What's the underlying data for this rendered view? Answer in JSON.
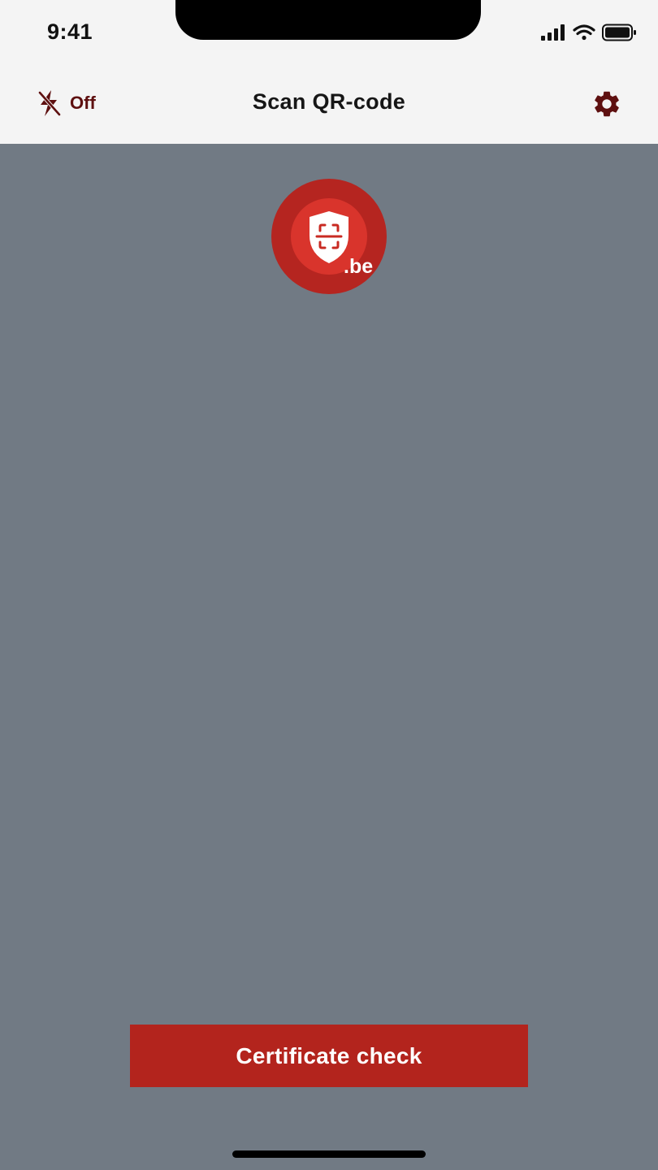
{
  "status_bar": {
    "time": "9:41",
    "icons": [
      "cellular-signal-icon",
      "wifi-icon",
      "battery-icon"
    ]
  },
  "nav": {
    "flash": {
      "icon": "flash-off-icon",
      "label": "Off"
    },
    "title": "Scan QR-code",
    "settings_icon": "gear-icon"
  },
  "logo": {
    "icon": "shield-scan-icon",
    "suffix": ".be"
  },
  "cta": {
    "label": "Certificate check"
  },
  "colors": {
    "brand_red": "#b3241d",
    "logo_outer": "#b52520",
    "logo_inner": "#d9342c",
    "dark_accent": "#5e1010",
    "camera_bg": "#717a84",
    "bar_bg": "#f4f4f4"
  }
}
